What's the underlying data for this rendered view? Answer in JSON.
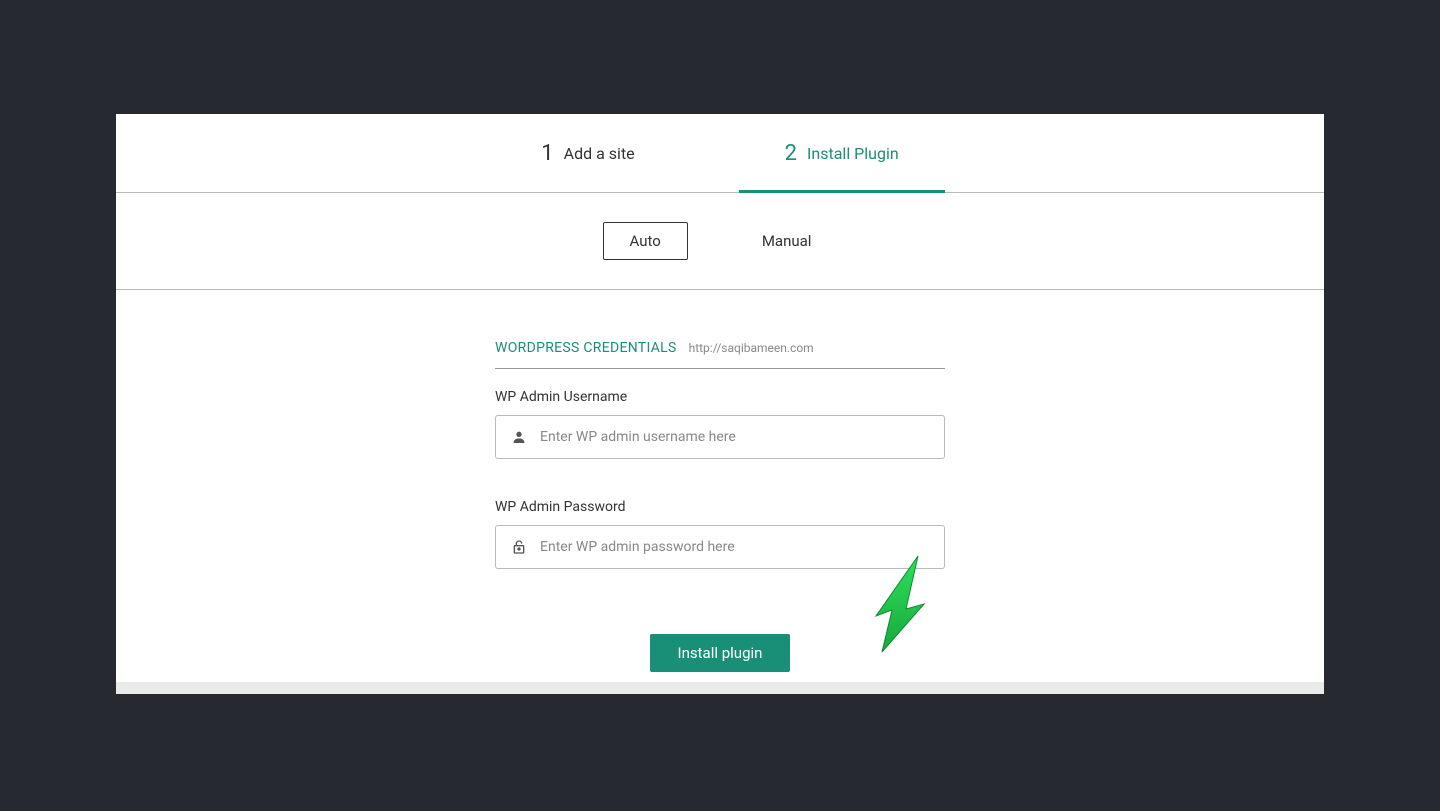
{
  "steps": [
    {
      "num": "1",
      "label": "Add a site",
      "active": false
    },
    {
      "num": "2",
      "label": "Install Plugin",
      "active": true
    }
  ],
  "modes": {
    "auto": "Auto",
    "manual": "Manual"
  },
  "section": {
    "title": "WORDPRESS CREDENTIALS",
    "url": "http://saqibameen.com"
  },
  "username": {
    "label": "WP Admin Username",
    "placeholder": "Enter WP admin username here",
    "value": ""
  },
  "password": {
    "label": "WP Admin Password",
    "placeholder": "Enter WP admin password here",
    "value": ""
  },
  "submit": "Install plugin",
  "colors": {
    "accent": "#1a8f78",
    "bg": "#262a30",
    "panel": "#ffffff",
    "arrow": "#22c245"
  }
}
